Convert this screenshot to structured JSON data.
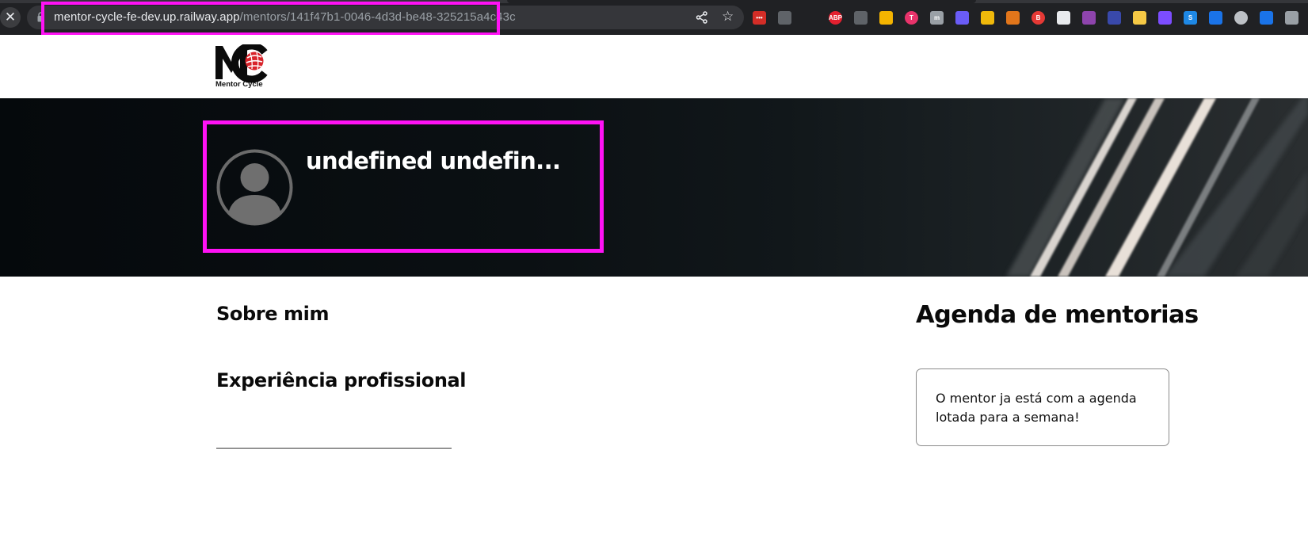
{
  "browser": {
    "url_host": "mentor-cycle-fe-dev.up.railway.app",
    "url_path": "/mentors/141f47b1-0046-4d3d-be48-325215a4c43c",
    "stop_icon": "close-icon",
    "extensions": [
      {
        "name": "lastpass-icon",
        "color": "#d32d27",
        "text": "•••"
      },
      {
        "name": "mask-icon",
        "color": "#5f6368",
        "text": ""
      },
      {
        "name": "hand-icon",
        "color": "#202124",
        "text": ""
      },
      {
        "name": "abp-icon",
        "color": "#e3202f",
        "text": "ABP"
      },
      {
        "name": "bookmark-icon",
        "color": "#5f6368",
        "text": ""
      },
      {
        "name": "apps-icon",
        "color": "#f4b400",
        "text": ""
      },
      {
        "name": "t-icon",
        "color": "#e8336b",
        "text": "T"
      },
      {
        "name": "m-icon",
        "color": "#9aa0a6",
        "text": "m"
      },
      {
        "name": "gear-icon",
        "color": "#6a5cf6",
        "text": ""
      },
      {
        "name": "bnb-icon",
        "color": "#f0b90b",
        "text": ""
      },
      {
        "name": "metamask-icon",
        "color": "#e2761b",
        "text": ""
      },
      {
        "name": "record-icon",
        "color": "#e53935",
        "text": "B"
      },
      {
        "name": "calendar-icon",
        "color": "#e8eaed",
        "text": ""
      },
      {
        "name": "bike-icon",
        "color": "#8e44ad",
        "text": ""
      },
      {
        "name": "arrow-icon",
        "color": "#3949ab",
        "text": ""
      },
      {
        "name": "notes-icon",
        "color": "#f6c945",
        "text": ""
      },
      {
        "name": "mountain-icon",
        "color": "#7c4dff",
        "text": ""
      },
      {
        "name": "s-icon",
        "color": "#1e88e5",
        "text": "S"
      },
      {
        "name": "screen-icon",
        "color": "#1a73e8",
        "text": ""
      },
      {
        "name": "target-icon",
        "color": "#bdc1c6",
        "text": ""
      },
      {
        "name": "square-icon",
        "color": "#1a73e8",
        "text": ""
      },
      {
        "name": "profile-icon",
        "color": "#9aa0a6",
        "text": ""
      }
    ]
  },
  "header": {
    "logo_text": "Mentor Cycle"
  },
  "profile": {
    "name": "undefined undefin..."
  },
  "about": {
    "title": "Sobre mim"
  },
  "experience": {
    "title": "Experiência profissional"
  },
  "agenda": {
    "title": "Agenda de mentorias",
    "message": "O mentor ja está com a agenda lotada para a semana!"
  },
  "colors": {
    "highlight": "#ff12f5",
    "brand_red": "#d8232a"
  }
}
